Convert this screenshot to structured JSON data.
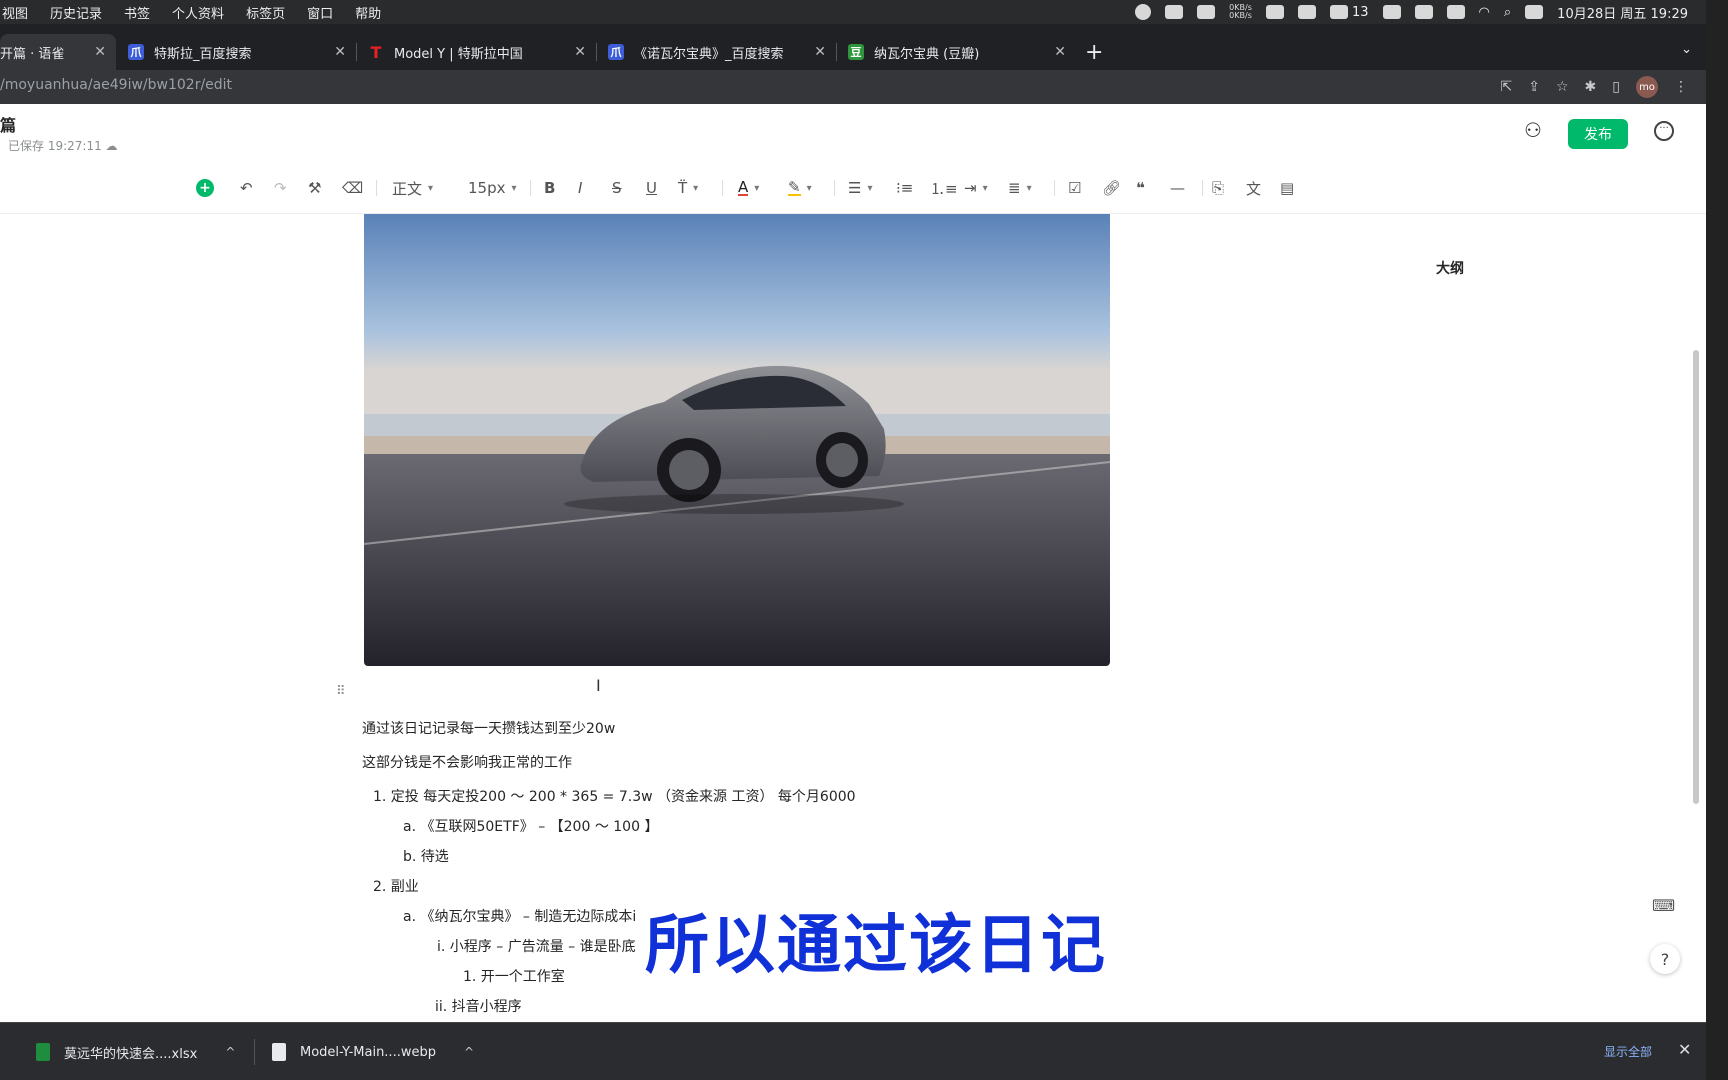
{
  "menubar": {
    "items": [
      "视图",
      "历史记录",
      "书签",
      "个人资料",
      "标签页",
      "窗口",
      "帮助"
    ],
    "netspeed_up": "0KB/s",
    "netspeed_down": "0KB/s",
    "wechat_count": "13",
    "datetime": "10月28日 周五  19:29"
  },
  "tabs": [
    {
      "label": "开篇 · 语雀",
      "icon": "yuque-icon"
    },
    {
      "label": "特斯拉_百度搜索",
      "icon": "baidu-icon"
    },
    {
      "label": "Model Y | 特斯拉中国",
      "icon": "tesla-icon"
    },
    {
      "label": "《诺瓦尔宝典》_百度搜索",
      "icon": "baidu-icon"
    },
    {
      "label": "纳瓦尔宝典 (豆瓣)",
      "icon": "douban-icon"
    }
  ],
  "address": {
    "url": "/moyuanhua/ae49iw/bw102r/edit",
    "avatar": "mo"
  },
  "doc": {
    "title": "篇",
    "saved": "已保存 19:27:11",
    "publish_label": "发布"
  },
  "toolbar": {
    "style": "正文",
    "size": "15px"
  },
  "content": {
    "line1": "通过该日记记录每一天攒钱达到至少20w",
    "line2": "这部分钱是不会影响我正常的工作",
    "item1": "1.  定投  每天定投200 ～   200 * 365 = 7.3w  （资金来源 工资）  每个月6000",
    "item1a": "a.  《互联网50ETF》 – 【200 ～ 100 】",
    "item1b": "b.  待选",
    "item2": "2.  副业",
    "item2a": "a.  《纳瓦尔宝典》 – 制造无边际成本i",
    "item2ai": "i.  小程序 – 广告流量 – 谁是卧底",
    "item2ai1": "1.  开一个工作室",
    "item2aii": "ii.  抖音小程序"
  },
  "outline_label": "大纲",
  "video_subtitle": "所以通过该日记",
  "downloads": {
    "items": [
      "莫远华的快速会....xlsx",
      "Model-Y-Main....webp"
    ],
    "show_all": "显示全部"
  },
  "colors": {
    "accent": "#00b96b",
    "subtitle": "#1030d8"
  }
}
